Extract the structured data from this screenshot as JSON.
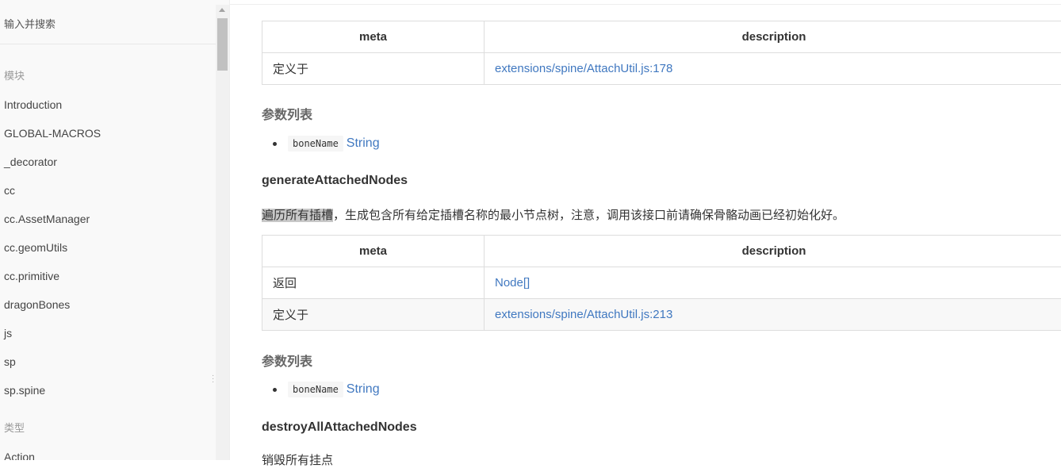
{
  "sidebar": {
    "search_placeholder": "输入并搜索",
    "modules_heading": "模块",
    "modules": [
      "Introduction",
      "GLOBAL-MACROS",
      "_decorator",
      "cc",
      "cc.AssetManager",
      "cc.geomUtils",
      "cc.primitive",
      "dragonBones",
      "js",
      "sp",
      "sp.spine"
    ],
    "types_heading": "类型",
    "types": [
      "Action"
    ]
  },
  "content": {
    "table1": {
      "headers": [
        "meta",
        "description"
      ],
      "rows": [
        {
          "meta": "定义于",
          "description": "extensions/spine/AttachUtil.js:178"
        }
      ]
    },
    "params_label_1": "参数列表",
    "param1": {
      "name": "boneName",
      "type": "String"
    },
    "method2": {
      "name": "generateAttachedNodes",
      "desc_highlight": "遍历所有插槽",
      "desc_rest": "，生成包含所有给定插槽名称的最小节点树，注意，调用该接口前请确保骨骼动画已经初始化好。"
    },
    "table2": {
      "headers": [
        "meta",
        "description"
      ],
      "rows": [
        {
          "meta": "返回",
          "description": "Node[]"
        },
        {
          "meta": "定义于",
          "description": "extensions/spine/AttachUtil.js:213"
        }
      ]
    },
    "params_label_2": "参数列表",
    "param2": {
      "name": "boneName",
      "type": "String"
    },
    "method3": {
      "name": "destroyAllAttachedNodes",
      "desc": "销毁所有挂点"
    }
  },
  "colors": {
    "link": "#4078c0",
    "sidebar_bg": "#f9f9f9"
  }
}
